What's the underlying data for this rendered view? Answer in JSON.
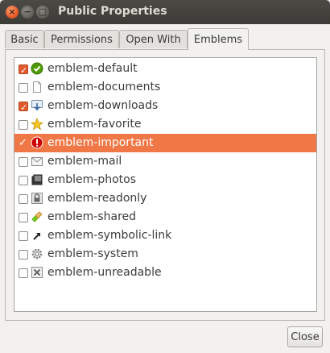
{
  "window": {
    "title": "Public Properties"
  },
  "tabs": [
    {
      "label": "Basic"
    },
    {
      "label": "Permissions"
    },
    {
      "label": "Open With"
    },
    {
      "label": "Emblems"
    }
  ],
  "emblems": [
    {
      "label": "emblem-default",
      "checked": true,
      "icon": "check-circle-icon"
    },
    {
      "label": "emblem-documents",
      "checked": false,
      "icon": "document-icon"
    },
    {
      "label": "emblem-downloads",
      "checked": true,
      "icon": "download-icon"
    },
    {
      "label": "emblem-favorite",
      "checked": false,
      "icon": "star-icon"
    },
    {
      "label": "emblem-important",
      "checked": true,
      "icon": "exclamation-icon",
      "selected": true
    },
    {
      "label": "emblem-mail",
      "checked": false,
      "icon": "mail-icon"
    },
    {
      "label": "emblem-photos",
      "checked": false,
      "icon": "photos-icon"
    },
    {
      "label": "emblem-readonly",
      "checked": false,
      "icon": "lock-icon"
    },
    {
      "label": "emblem-shared",
      "checked": false,
      "icon": "shared-icon"
    },
    {
      "label": "emblem-symbolic-link",
      "checked": false,
      "icon": "arrow-link-icon"
    },
    {
      "label": "emblem-system",
      "checked": false,
      "icon": "gear-icon"
    },
    {
      "label": "emblem-unreadable",
      "checked": false,
      "icon": "unreadable-icon"
    }
  ],
  "buttons": {
    "close": "Close"
  },
  "colors": {
    "accent": "#f07746",
    "titlebar": "#3c3b37"
  }
}
